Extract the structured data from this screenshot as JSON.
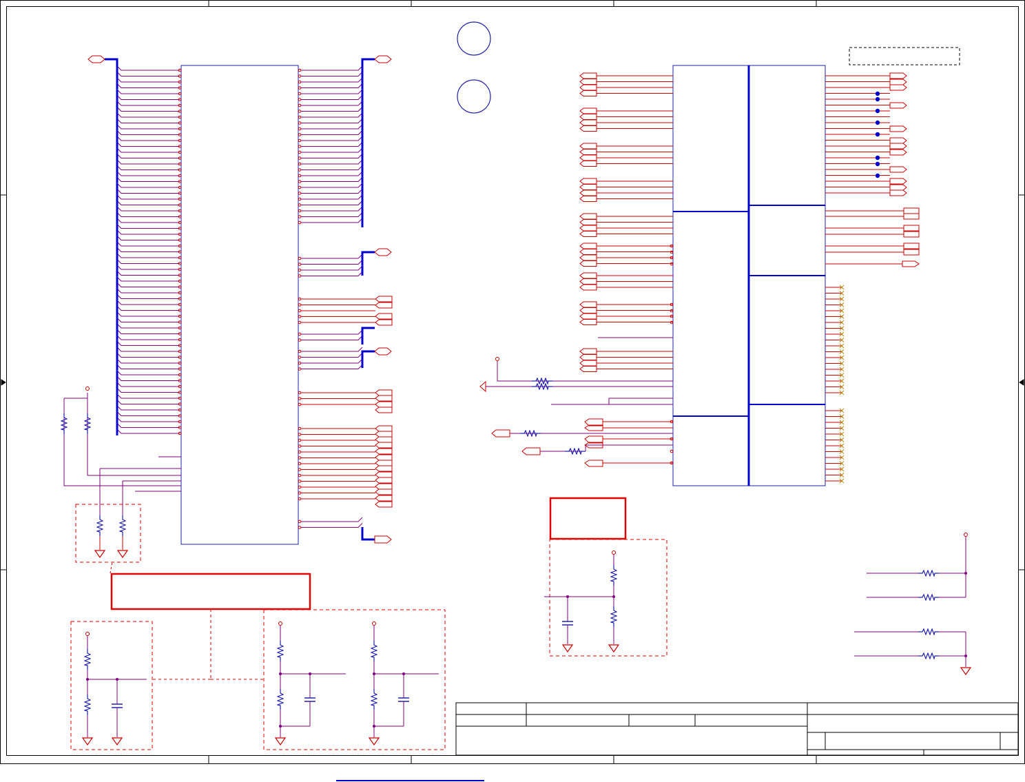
{
  "sheet": {
    "width": 1488,
    "height": 1135,
    "colors": {
      "paper": "#ffffff",
      "frame": "#000000",
      "wire": "#cc0000",
      "bus": "#0000cc",
      "net_purple": "#800080",
      "component_blue": "#2020aa",
      "annotation_red": "#e00000",
      "no_connect": "#b8860b"
    },
    "icons": {
      "resistor": "resistor-icon",
      "capacitor": "capacitor-icon",
      "ground": "ground-icon",
      "power": "power-pin-icon",
      "port": "net-port-icon",
      "junction": "junction-dot-icon",
      "no_connect": "no-connect-icon",
      "mounting_hole": "mounting-hole-icon"
    }
  }
}
